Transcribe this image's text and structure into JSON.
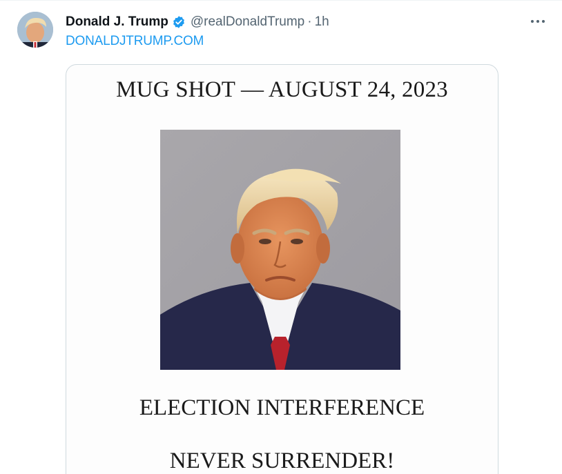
{
  "tweet": {
    "author_name": "Donald J. Trump",
    "handle": "@realDonaldTrump",
    "separator": "·",
    "time": "1h",
    "link_text": "DONALDJTRUMP.COM",
    "verified_color": "#1d9bf0",
    "more_icon": "more-horizontal-icon"
  },
  "media": {
    "title": "MUG SHOT — AUGUST 24, 2023",
    "line1": "ELECTION INTERFERENCE",
    "line2": "NEVER SURRENDER!"
  }
}
